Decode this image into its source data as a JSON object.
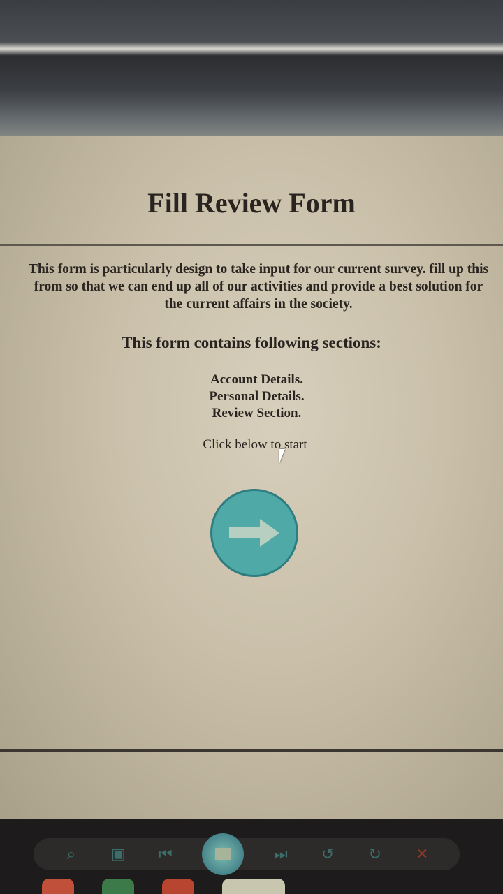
{
  "page": {
    "title": "Fill Review Form",
    "intro": "This form is particularly design to take input for our current survey. fill up this from so that we can end up all of our activities and provide a best solution for the current affairs in the society.",
    "sections_heading": "This form contains following sections:",
    "sections": [
      "Account Details.",
      "Personal Details.",
      "Review Section."
    ],
    "cta": "Click below to start",
    "start_icon": "arrow-right-icon",
    "accent": "#4fa9a7"
  },
  "viewer_toolbar": {
    "icons": [
      "zoom-icon",
      "actual-size-icon",
      "previous-icon",
      "slideshow-icon",
      "next-icon",
      "rotate-left-icon",
      "rotate-right-icon",
      "delete-icon"
    ]
  },
  "taskbar": {
    "icons": [
      "chrome-icon",
      "excel-icon",
      "powerpoint-icon",
      "photo-viewer-icon"
    ]
  }
}
